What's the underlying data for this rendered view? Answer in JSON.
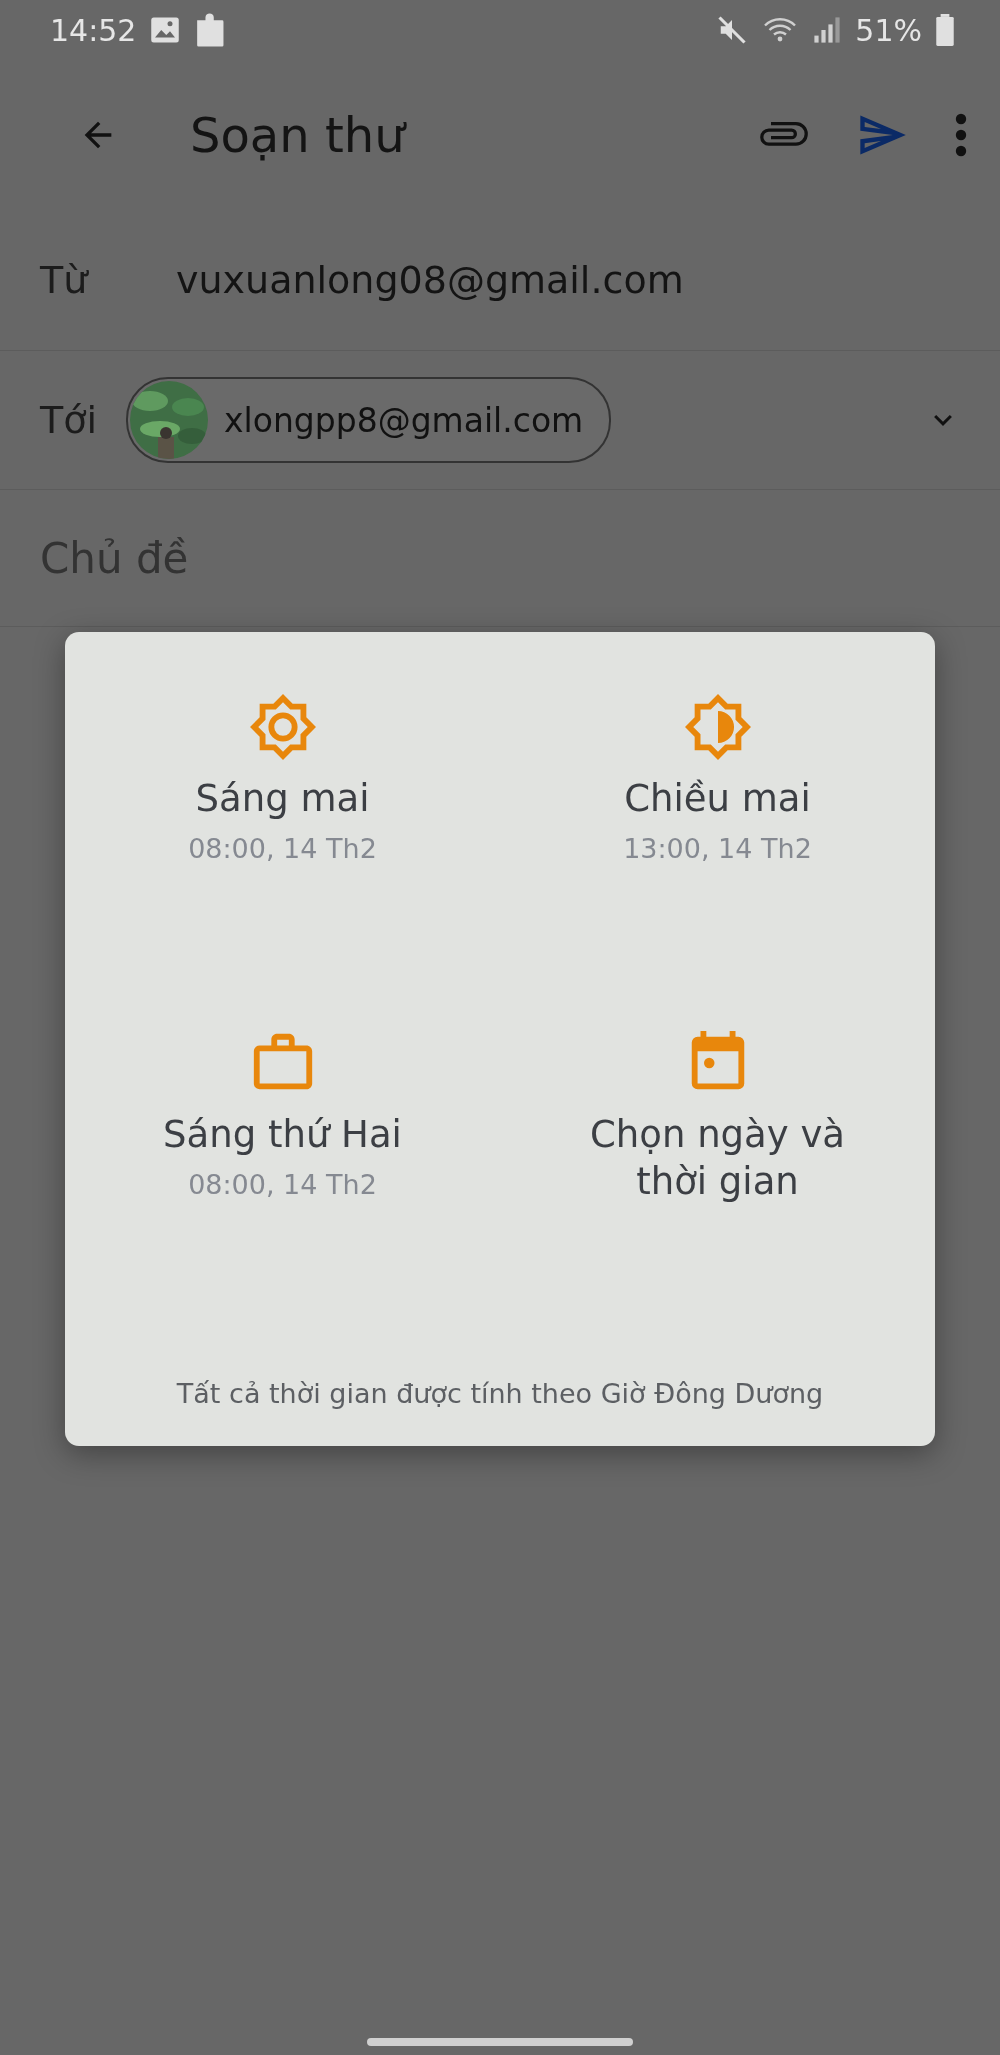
{
  "status_bar": {
    "time": "14:52",
    "battery": "51%"
  },
  "app_bar": {
    "title": "Soạn thư"
  },
  "compose": {
    "from": {
      "label": "Từ",
      "value": "vuxuanlong08@gmail.com"
    },
    "to": {
      "label": "Tới",
      "chip": "xlongpp8@gmail.com"
    },
    "subject": {
      "placeholder": "Chủ đề"
    }
  },
  "schedule_dialog": {
    "options": [
      {
        "title": "Sáng mai",
        "subtitle": "08:00, 14 Th2"
      },
      {
        "title": "Chiều mai",
        "subtitle": "13:00, 14 Th2"
      },
      {
        "title": "Sáng thứ Hai",
        "subtitle": "08:00, 14 Th2"
      },
      {
        "title": "Chọn ngày và thời gian"
      }
    ],
    "footnote": "Tất cả thời gian được tính theo Giờ Đông Dương"
  }
}
